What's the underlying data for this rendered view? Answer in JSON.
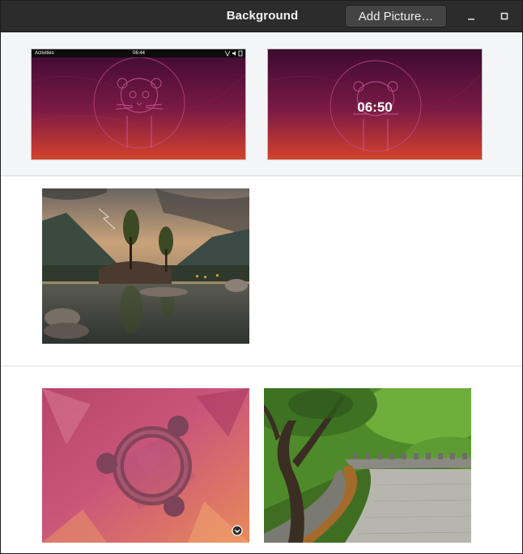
{
  "window": {
    "title": "Background"
  },
  "header": {
    "add_picture_label": "Add Picture…"
  },
  "preview": {
    "desktop": {
      "panel_activities": "Activities",
      "panel_clock": "06:44"
    },
    "lock_screen": {
      "clock": "06:50"
    }
  },
  "wallpapers": [
    {
      "name": "mountain-lake-storm",
      "section": "pictures",
      "selected": false
    },
    {
      "name": "ubuntu-logo-abstract",
      "section": "backgrounds",
      "selected": true
    },
    {
      "name": "stone-walkway-forest",
      "section": "backgrounds",
      "selected": false
    }
  ],
  "colors": {
    "titlebar": "#2c2c2c",
    "preview_background": "#f4f5f6",
    "wallpaper_top": "#3d0a32",
    "wallpaper_bottom": "#d2432b"
  }
}
